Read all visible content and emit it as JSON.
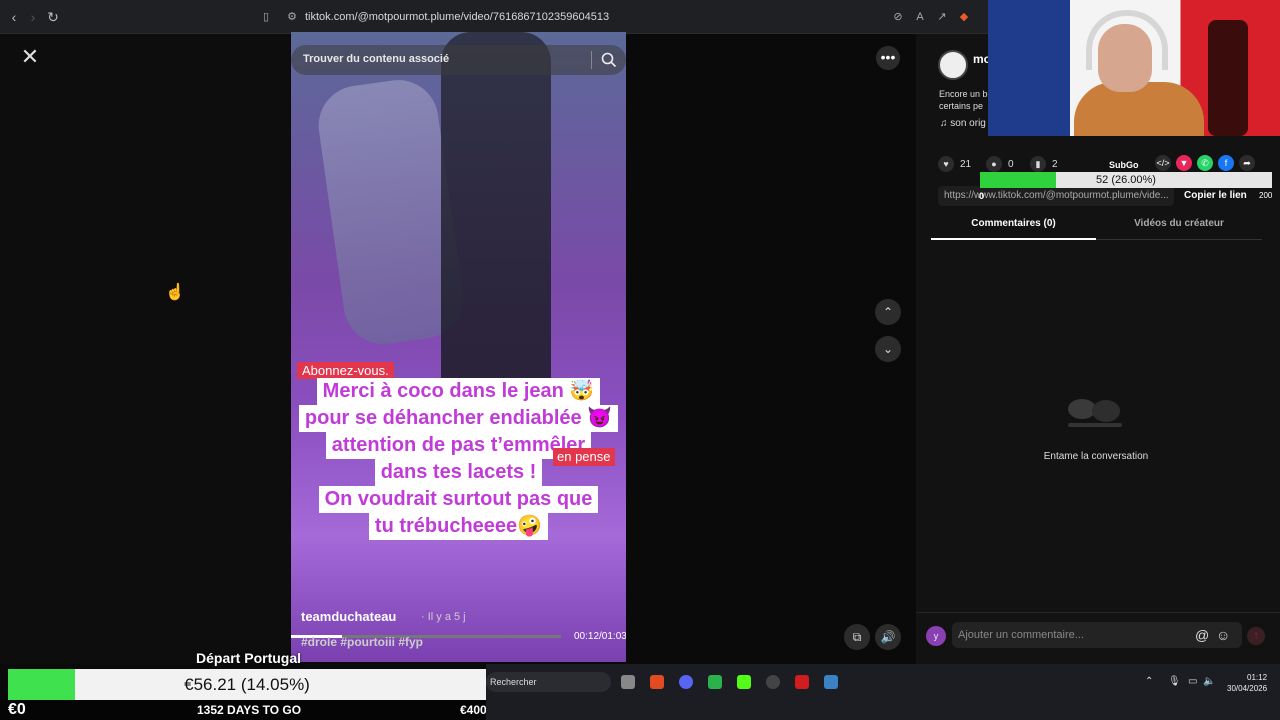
{
  "browser": {
    "url": "tiktok.com/@motpourmot.plume/video/7616867102359604513",
    "back": "‹",
    "forward": "›",
    "reload": "↻"
  },
  "video": {
    "search_placeholder": "Trouver du contenu associé",
    "follow_banner": "Abonnez-vous.",
    "caption_lines": [
      "Merci à coco dans le jean 🤯",
      "pour se déhancher endiablée 😈",
      "attention de pas t’emmêler",
      "dans tes lacets !",
      "On voudrait surtout pas que",
      "tu trébucheeee🤪"
    ],
    "side_tag": "en pense",
    "author": "teamduchateau",
    "author_ago": "· Il y a 5 j",
    "hashtags": "#drole #pourtoiii #fyp",
    "time": "00:12/01:03",
    "progress": 0.19
  },
  "sidebar": {
    "close": "✕",
    "more": "•••",
    "up": "⌃",
    "down": "⌄"
  },
  "creator": {
    "name": "mo",
    "desc1": "Encore un b",
    "desc2": "certains pe",
    "music": "♫  son orig"
  },
  "stats": {
    "likes": "21",
    "comments": "0",
    "saves": "2"
  },
  "subgoal": {
    "label": "SubGo",
    "text": "52 (26.00%)",
    "fraction": 0.26,
    "min": "0",
    "max": "200"
  },
  "share": {
    "link": "https://www.tiktok.com/@motpourmot.plume/vide...",
    "copy": "Copier le lien"
  },
  "tabs": {
    "comments": "Commentaires (0)",
    "videos": "Vidéos du créateur"
  },
  "comments_empty": "Entame la conversation",
  "comment_input": {
    "placeholder": "Ajouter un commentaire...",
    "avatar_letter": "y"
  },
  "stream_goal": {
    "title": "Départ Portugal",
    "amount": "€56.21 (14.05%)",
    "fraction": 0.1405,
    "min": "€0",
    "days": "1352 DAYS TO GO",
    "max": "€400"
  },
  "taskbar": {
    "search": "Rechercher",
    "time": "01:12",
    "date": "30/04/2026"
  }
}
